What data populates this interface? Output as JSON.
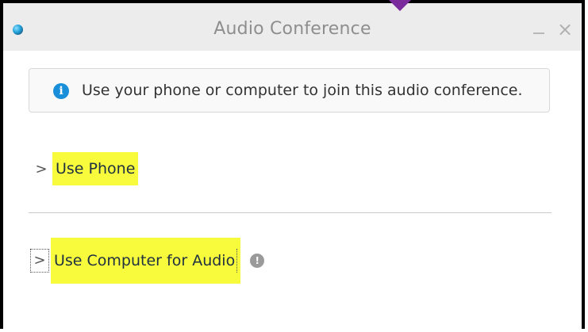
{
  "window": {
    "title": "Audio Conference",
    "minimize_glyph": "–",
    "close_glyph": "×"
  },
  "info": {
    "icon": "info-icon",
    "icon_glyph": "i",
    "text": "Use your phone or computer to join this audio conference."
  },
  "options": {
    "phone": {
      "label": "Use Phone",
      "chevron": ">"
    },
    "computer": {
      "label": "Use Computer for Audio",
      "chevron": ">",
      "help_glyph": "!"
    }
  },
  "colors": {
    "highlight": "#f7fb3c",
    "info_blue": "#1a8fd9",
    "marker_purple": "#7a2a9a"
  }
}
